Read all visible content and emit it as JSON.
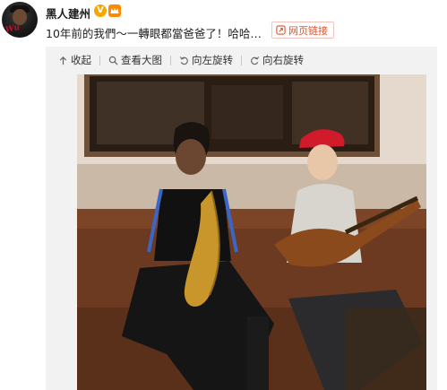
{
  "user": {
    "name": "黑人建州",
    "verified_badge": "V"
  },
  "post": {
    "text": "10年前的我們～一轉眼都當爸爸了！哈哈…",
    "link_button_label": "网页链接"
  },
  "toolbar": {
    "collapse_label": "收起",
    "view_large_label": "查看大图",
    "rotate_left_label": "向左旋转",
    "rotate_right_label": "向右旋转"
  },
  "colors": {
    "link_accent": "#e2502c",
    "verified_badge": "#f5a700",
    "toolbar_background": "#f2f2f2"
  }
}
